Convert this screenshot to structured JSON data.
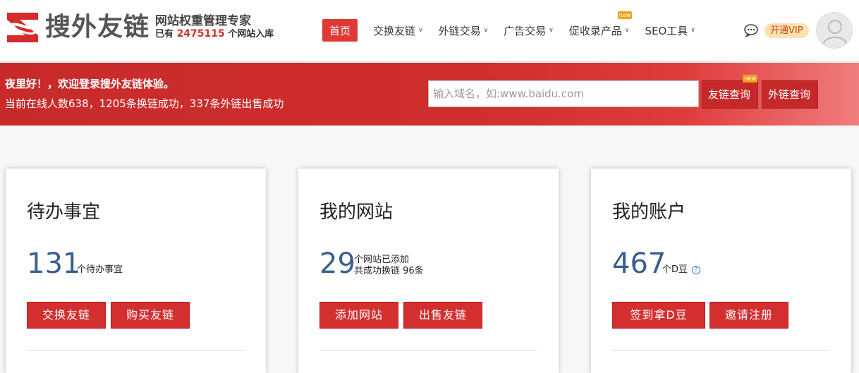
{
  "header": {
    "logo_name": "搜外友链",
    "slogan": "网站权重管理专家",
    "count_prefix": "已有",
    "count_value": "2475115",
    "count_suffix": "个网站入库",
    "nav": [
      {
        "label": "首页",
        "active": true,
        "caret": false,
        "new": false
      },
      {
        "label": "交换友链",
        "active": false,
        "caret": true,
        "new": false
      },
      {
        "label": "外链交易",
        "active": false,
        "caret": true,
        "new": false
      },
      {
        "label": "广告交易",
        "active": false,
        "caret": true,
        "new": false
      },
      {
        "label": "促收录产品",
        "active": false,
        "caret": true,
        "new": true
      },
      {
        "label": "SEO工具",
        "active": false,
        "caret": true,
        "new": false
      }
    ],
    "new_badge": "new",
    "vip_label": "开通VIP",
    "icons": {
      "chat": "chat-bubble-icon",
      "avatar": "user-avatar-icon"
    }
  },
  "banner": {
    "greeting": "夜里好！，欢迎登录搜外友链体验。",
    "stats": "当前在线人数638，1205条换链成功，337条外链出售成功",
    "search_placeholder": "输入域名，如:www.baidu.com",
    "btn_friend_query": "友链查询",
    "btn_outlink_query": "外链查询"
  },
  "cards": [
    {
      "title": "待办事宜",
      "number": "131",
      "note1": "个待办事宜",
      "note2": "",
      "btn1": "交换友链",
      "btn2": "购买友链"
    },
    {
      "title": "我的网站",
      "number": "29",
      "note1": "个网站已添加",
      "note2": "共成功换链 96条",
      "btn1": "添加网站",
      "btn2": "出售友链"
    },
    {
      "title": "我的账户",
      "number": "467",
      "note1": "个D豆",
      "note2": "",
      "btn1": "签到拿D豆",
      "btn2": "邀请注册"
    }
  ],
  "colors": {
    "brand_red": "#d32f2f",
    "number_blue": "#3a5f8f",
    "vip_bg": "#fde2b0"
  }
}
